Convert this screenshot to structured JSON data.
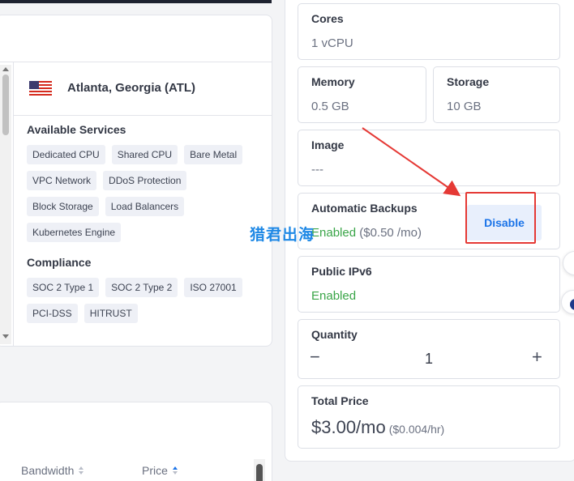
{
  "location": {
    "name": "Atlanta, Georgia (ATL)",
    "flag_icon": "us-flag-icon",
    "services_title": "Available Services",
    "services": [
      "Dedicated CPU",
      "Shared CPU",
      "Bare Metal",
      "VPC Network",
      "DDoS Protection",
      "Block Storage",
      "Load Balancers",
      "Kubernetes Engine"
    ],
    "compliance_title": "Compliance",
    "compliance": [
      "SOC 2 Type 1",
      "SOC 2 Type 2",
      "ISO 27001",
      "PCI-DSS",
      "HITRUST"
    ]
  },
  "table": {
    "columns": [
      "Bandwidth",
      "Price"
    ]
  },
  "summary": {
    "cores": {
      "label": "Cores",
      "value": "1 vCPU"
    },
    "memory": {
      "label": "Memory",
      "value": "0.5 GB"
    },
    "storage": {
      "label": "Storage",
      "value": "10 GB"
    },
    "image": {
      "label": "Image",
      "value": "---"
    },
    "backups": {
      "label": "Automatic Backups",
      "status": "Enabled",
      "price": "($0.50 /mo)",
      "button": "Disable"
    },
    "ipv6": {
      "label": "Public IPv6",
      "status": "Enabled"
    },
    "quantity": {
      "label": "Quantity",
      "value": "1",
      "minus": "−",
      "plus": "+"
    },
    "total": {
      "label": "Total Price",
      "price": "$3.00/mo",
      "hourly": "($0.004/hr)"
    }
  },
  "watermark": "猎君出海",
  "colors": {
    "accent": "#1a73e8",
    "enabled": "#3aa548",
    "annotation": "#e53935"
  }
}
